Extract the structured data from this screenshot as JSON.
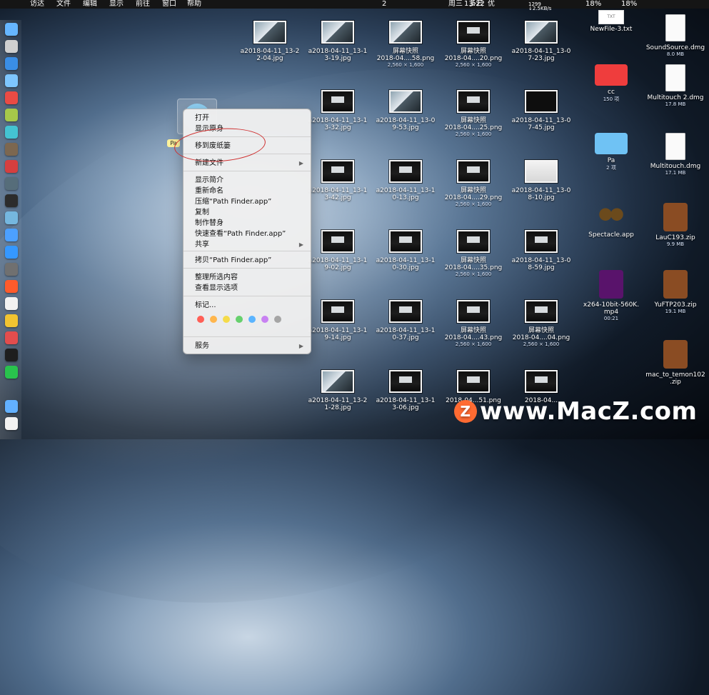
{
  "menubar": {
    "apple": "",
    "items": [
      "访达",
      "文件",
      "编辑",
      "显示",
      "前往",
      "窗口",
      "帮助"
    ],
    "right": {
      "day": "周三",
      "time": "13:22",
      "user": "多云",
      "user2": "优",
      "wifi": "1299",
      "speed": "↓2.5KB/s",
      "battery": "18%",
      "battery2": "18%",
      "chat": "2"
    }
  },
  "context_menu": {
    "items": [
      "打开",
      "显示原身",
      "移到废纸篓",
      "新建文件",
      "显示简介",
      "重新命名",
      "压缩“Path Finder.app”",
      "复制",
      "制作替身",
      "快速查看“Path Finder.app”",
      "共享",
      "拷贝“Path Finder.app”",
      "整理所选内容",
      "查看显示选项",
      "标记...",
      "服务"
    ]
  },
  "desktop": {
    "selected_label": "Pa",
    "items": [
      {
        "name": "a2018-04-11_13-2\n2-04.jpg",
        "meta": ""
      },
      {
        "name": "a2018-04-11_13-1\n3-19.jpg",
        "meta": ""
      },
      {
        "name": "屏幕快照\n2018-04....58.png",
        "meta": "2,560 × 1,600"
      },
      {
        "name": "屏幕快照\n2018-04....20.png",
        "meta": "2,560 × 1,600"
      },
      {
        "name": "a2018-04-11_13-0\n7-23.jpg",
        "meta": ""
      },
      {
        "name": "a2018-04-11_13-1\n3-32.jpg",
        "meta": ""
      },
      {
        "name": "a2018-04-11_13-0\n9-53.jpg",
        "meta": ""
      },
      {
        "name": "屏幕快照\n2018-04....25.png",
        "meta": "2,560 × 1,600"
      },
      {
        "name": "a2018-04-11_13-0\n7-45.jpg",
        "meta": ""
      },
      {
        "name": "a2018-04-11_13-1\n3-42.jpg",
        "meta": ""
      },
      {
        "name": "a2018-04-11_13-1\n0-13.jpg",
        "meta": ""
      },
      {
        "name": "屏幕快照\n2018-04....29.png",
        "meta": "2,560 × 1,600"
      },
      {
        "name": "a2018-04-11_13-0\n8-10.jpg",
        "meta": ""
      },
      {
        "name": "a2018-04-11_13-1\n9-02.jpg",
        "meta": ""
      },
      {
        "name": "a2018-04-11_13-1\n0-30.jpg",
        "meta": ""
      },
      {
        "name": "屏幕快照\n2018-04....35.png",
        "meta": "2,560 × 1,600"
      },
      {
        "name": "a2018-04-11_13-0\n8-59.jpg",
        "meta": ""
      },
      {
        "name": "a2018-04-11_13-1\n9-14.jpg",
        "meta": ""
      },
      {
        "name": "a2018-04-11_13-1\n0-37.jpg",
        "meta": ""
      },
      {
        "name": "屏幕快照\n2018-04....43.png",
        "meta": "2,560 × 1,600"
      },
      {
        "name": "屏幕快照\n2018-04....04.png",
        "meta": "2,560 × 1,600"
      },
      {
        "name": "a2018-04-11_13-2\n1-28.jpg",
        "meta": ""
      },
      {
        "name": "a2018-04-11_13-1\n3-06.jpg",
        "meta": ""
      },
      {
        "name": "2018-04...51.png",
        "meta": ""
      },
      {
        "name": "2018-04...",
        "meta": ""
      },
      {
        "name": "NewFile-3.txt",
        "meta": ""
      },
      {
        "name": "SoundSource.dmg",
        "meta": "8.0 MB"
      },
      {
        "name": "cc",
        "meta": "150 项"
      },
      {
        "name": "Multitouch 2.dmg",
        "meta": "17.8 MB"
      },
      {
        "name": "Pa",
        "meta": "2 项"
      },
      {
        "name": "Multitouch.dmg",
        "meta": "17.1 MB"
      },
      {
        "name": "Spectacle.app",
        "meta": ""
      },
      {
        "name": "LauC193.zip",
        "meta": "9.9 MB"
      },
      {
        "name": "x264-10bit-560K.\nmp4",
        "meta": "00:21"
      },
      {
        "name": "YuFTP203.zip",
        "meta": "19.1 MB"
      },
      {
        "name": "mac_to_temon102\n.zip",
        "meta": ""
      }
    ]
  },
  "watermark": {
    "badge": "Z",
    "text": "www.MacZ.com"
  },
  "txt_badge": "TXT"
}
